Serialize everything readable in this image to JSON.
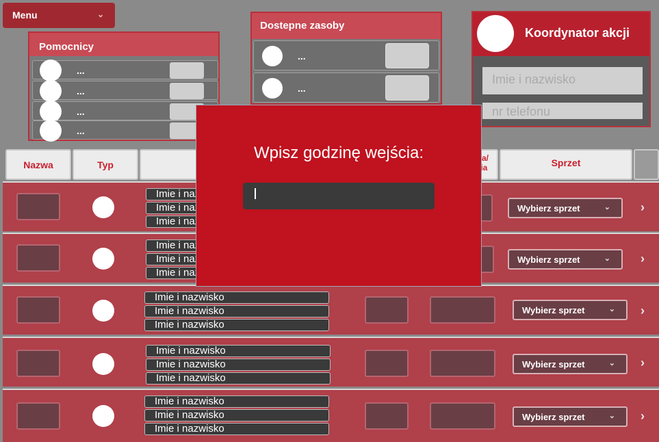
{
  "menu": {
    "label": "Menu"
  },
  "helpers": {
    "title": "Pomocnicy",
    "items": [
      {
        "label": "..."
      },
      {
        "label": "..."
      },
      {
        "label": "..."
      },
      {
        "label": "..."
      }
    ]
  },
  "resources": {
    "title": "Dostepne zasoby",
    "items": [
      {
        "label": "..."
      },
      {
        "label": "..."
      }
    ]
  },
  "coordinator": {
    "title": "Koordynator akcji",
    "name_placeholder": "Imie i nazwisko",
    "phone_placeholder": "nr telefonu"
  },
  "table": {
    "headers": {
      "name": "Nazwa",
      "type": "Typ",
      "entry_exit": "cia/\ncia",
      "equipment": "Sprzet"
    },
    "name_placeholder": "Imie i nazwisko",
    "select_label": "Wybierz sprzet"
  },
  "modal": {
    "title": "Wpisz godzinę wejścia:",
    "input_value": ""
  }
}
